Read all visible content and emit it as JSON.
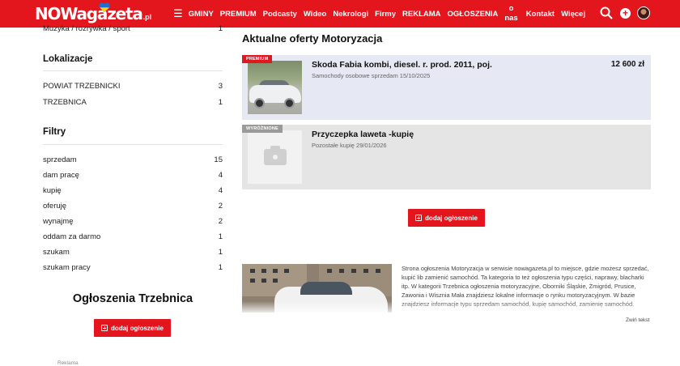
{
  "header": {
    "logo_text": "NOWagazeta",
    "logo_suffix": ".pl",
    "nav": [
      "GMINY",
      "PREMIUM",
      "Podcasty",
      "Wideo",
      "Nekrologi",
      "Firmy",
      "REKLAMA",
      "OGŁOSZENIA"
    ],
    "nav_onas_top": "o",
    "nav_onas_bottom": "nas",
    "nav_after": [
      "Kontakt",
      "Więcej"
    ],
    "icons": [
      "menu-icon",
      "search-icon",
      "plus-icon",
      "avatar"
    ],
    "colors": {
      "brand": "#e4161d"
    }
  },
  "sidebar": {
    "cut_item": {
      "label": "Muzyka / rozrywka / sport",
      "count": "1"
    },
    "locations_title": "Lokalizacje",
    "locations": [
      {
        "label": "POWIAT TRZEBNICKI",
        "count": "3"
      },
      {
        "label": "TRZEBNICA",
        "count": "1"
      }
    ],
    "filters_title": "Filtry",
    "filters": [
      {
        "label": "sprzedam",
        "count": "15"
      },
      {
        "label": "dam pracę",
        "count": "4"
      },
      {
        "label": "kupię",
        "count": "4"
      },
      {
        "label": "oferuję",
        "count": "2"
      },
      {
        "label": "wynajmę",
        "count": "2"
      },
      {
        "label": "oddam za darmo",
        "count": "1"
      },
      {
        "label": "szukam",
        "count": "1"
      },
      {
        "label": "szukam pracy",
        "count": "1"
      }
    ],
    "city_title": "Ogłoszenia Trzebnica",
    "add_button": "dodaj ogłoszenie",
    "ad_label": "Reklama"
  },
  "main": {
    "title": "Aktualne oferty Motoryzacja",
    "listings": [
      {
        "badge": "PREMIUM",
        "title": "Skoda Fabia kombi, diesel. r. prod. 2011, poj.",
        "subtitle": "Samochody osobowe sprzedam 15/10/2025",
        "price": "12 600 zł"
      },
      {
        "badge": "WYRÓŻNIONE",
        "title": "Przyczepka laweta -kupię",
        "subtitle": "Pozostałe kupię 29/01/2026",
        "price": ""
      }
    ],
    "add_button": "dodaj ogłoszenie",
    "article_text": "Strona ogłoszenia Motoryzacja w serwisie nowagazeta.pl to miejsce, gdzie możesz sprzedać, kupić lib zamienić samochód. Ta kategoria to też ogłoszenia typu części, naprawy, blacharki itp. W kategorii Trzebnica ogłoszenia motoryzacyjne, Oborniki Śląskie, Żmigród, Prusice, Zawonia i Wisznia Mała znajdziesz lokalne informacje o rynku motoryzacyjnym. W bazie znajdziesz informacje typu sprzedam samochód, kupię samochód, zamienię samochód.",
    "collapse_label": "Zwiń tekst"
  }
}
